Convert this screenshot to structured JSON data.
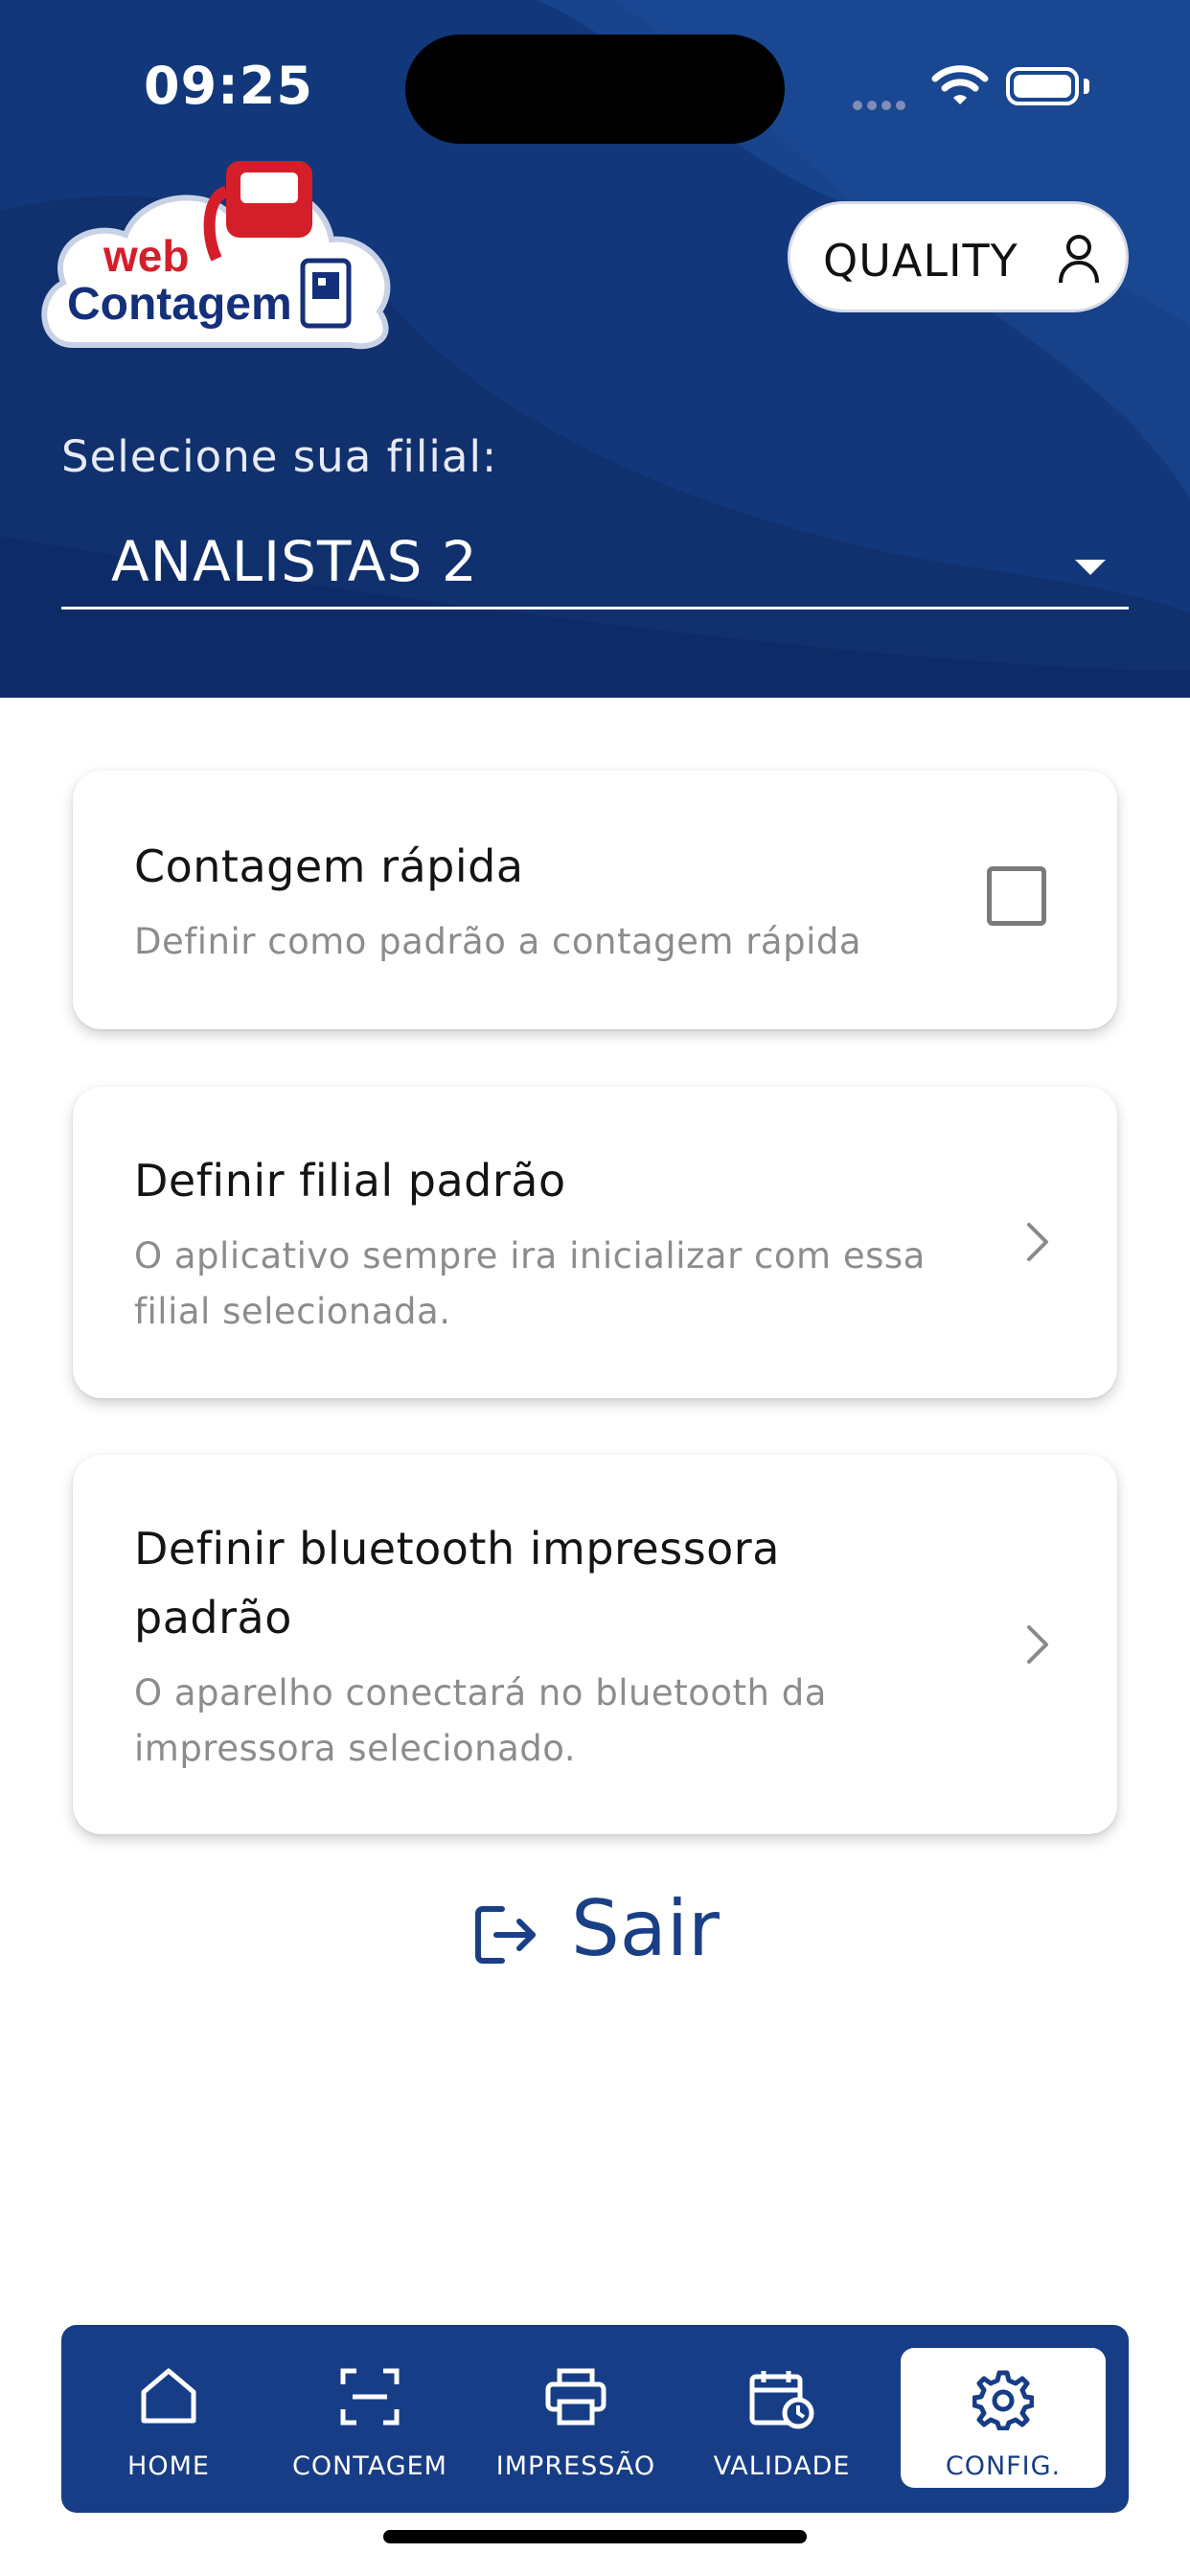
{
  "status_bar": {
    "time": "09:25"
  },
  "logo": {
    "word1": "web",
    "word2": "Contagem"
  },
  "user": {
    "name": "QUALITY"
  },
  "branch": {
    "label": "Selecione sua filial:",
    "value": "ANALISTAS 2"
  },
  "settings": [
    {
      "title": "Contagem rápida",
      "subtitle": "Definir como padrão a contagem rápida",
      "control": "checkbox",
      "checked": false
    },
    {
      "title": "Definir filial padrão",
      "subtitle": "O aplicativo sempre ira inicializar com essa filial selecionada.",
      "control": "chevron"
    },
    {
      "title": "Definir bluetooth impressora padrão",
      "subtitle": "O aparelho conectará no bluetooth da impressora selecionado.",
      "control": "chevron"
    }
  ],
  "logout": {
    "label": "Sair"
  },
  "nav": [
    {
      "label": "HOME",
      "icon": "home-icon"
    },
    {
      "label": "CONTAGEM",
      "icon": "scan-icon"
    },
    {
      "label": "IMPRESSÃO",
      "icon": "printer-icon"
    },
    {
      "label": "VALIDADE",
      "icon": "calendar-clock-icon"
    },
    {
      "label": "CONFIG.",
      "icon": "gear-icon",
      "active": true
    }
  ],
  "colors": {
    "primary": "#173d87",
    "header": "#12377a",
    "brand_red": "#d41f2a",
    "white": "#ffffff"
  }
}
